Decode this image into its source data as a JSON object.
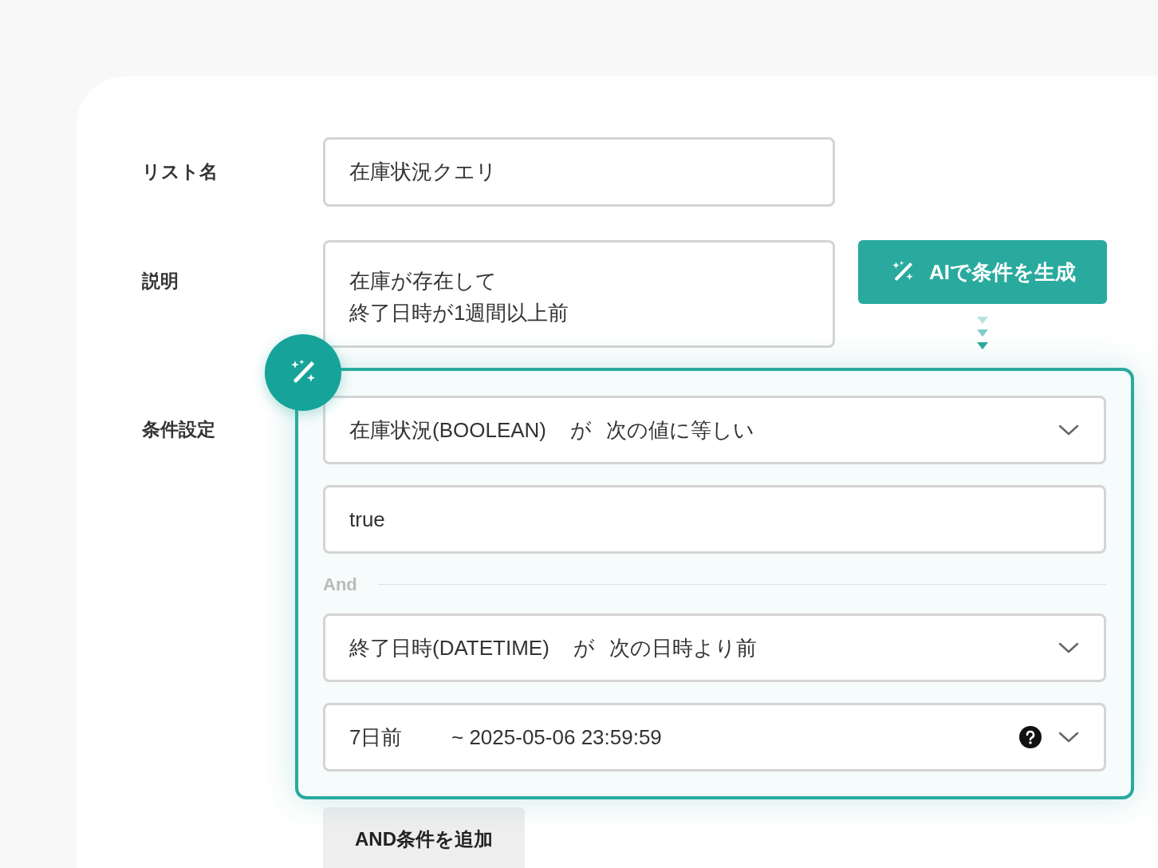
{
  "list_name": {
    "label": "リスト名",
    "value": "在庫状況クエリ"
  },
  "description": {
    "label": "説明",
    "lines": [
      "在庫が存在して",
      "終了日時が1週間以上前"
    ]
  },
  "ai_button": {
    "label": "AIで条件を生成"
  },
  "conditions": {
    "label": "条件設定",
    "joiner": "And",
    "groups": [
      {
        "field": "在庫状況(BOOLEAN)",
        "verb": "が",
        "operator": "次の値に等しい",
        "value": {
          "kind": "text",
          "text": "true"
        }
      },
      {
        "field": "終了日時(DATETIME)",
        "verb": "が",
        "operator": "次の日時より前",
        "value": {
          "kind": "date_select",
          "text": "7日前",
          "range": "~ 2025-05-06 23:59:59"
        }
      }
    ]
  },
  "add_button": {
    "label": "AND条件を追加"
  }
}
